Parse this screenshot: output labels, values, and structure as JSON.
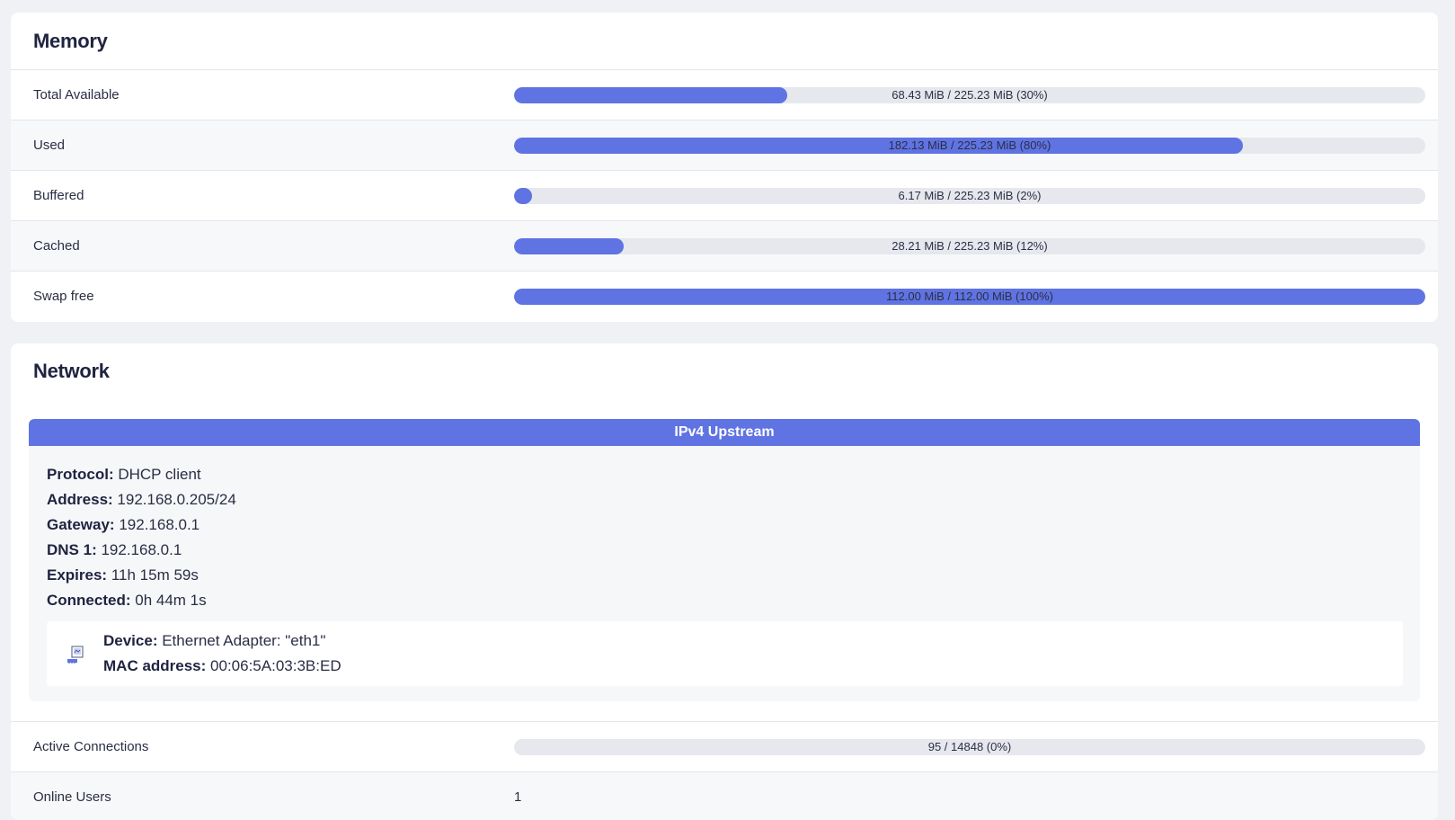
{
  "memory": {
    "title": "Memory",
    "rows": [
      {
        "label": "Total Available",
        "text": "68.43 MiB / 225.23 MiB (30%)",
        "percent": 30
      },
      {
        "label": "Used",
        "text": "182.13 MiB / 225.23 MiB (80%)",
        "percent": 80
      },
      {
        "label": "Buffered",
        "text": "6.17 MiB / 225.23 MiB (2%)",
        "percent": 2
      },
      {
        "label": "Cached",
        "text": "28.21 MiB / 225.23 MiB (12%)",
        "percent": 12
      },
      {
        "label": "Swap free",
        "text": "112.00 MiB / 112.00 MiB (100%)",
        "percent": 100
      }
    ]
  },
  "network": {
    "title": "Network",
    "upstream": {
      "header": "IPv4 Upstream",
      "protocol_label": "Protocol:",
      "protocol": "DHCP client",
      "address_label": "Address:",
      "address": "192.168.0.205/24",
      "gateway_label": "Gateway:",
      "gateway": "192.168.0.1",
      "dns_label": "DNS 1:",
      "dns": "192.168.0.1",
      "expires_label": "Expires:",
      "expires": "11h 15m 59s",
      "connected_label": "Connected:",
      "connected": "0h 44m 1s",
      "device_icon": "ethernet-adapter-icon",
      "device_label": "Device:",
      "device": "Ethernet Adapter: \"eth1\"",
      "mac_label": "MAC address:",
      "mac": "00:06:5A:03:3B:ED"
    },
    "active_connections": {
      "label": "Active Connections",
      "text": "95 / 14848 (0%)",
      "percent": 0
    },
    "online_users": {
      "label": "Online Users",
      "value": "1"
    }
  },
  "colors": {
    "accent": "#5f73e3",
    "track": "#e6e8ed",
    "page_bg": "#f0f1f5"
  }
}
